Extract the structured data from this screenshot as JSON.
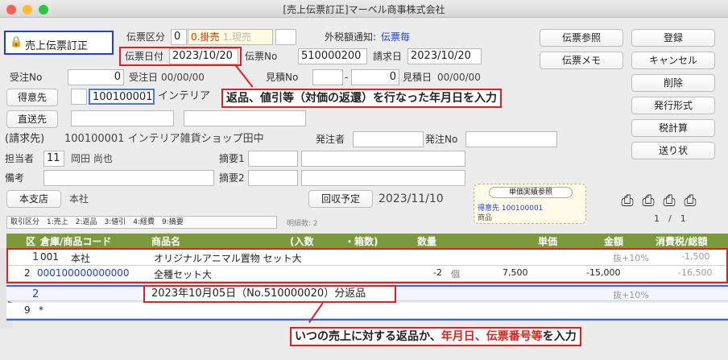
{
  "window": {
    "title": "[売上伝票訂正]マーベル商事株式会社"
  },
  "mode": {
    "label": "売上伝票訂正"
  },
  "header": {
    "kubun_label": "伝票区分",
    "kubun_value": "0",
    "kubun_opt1": "0.掛売",
    "kubun_opt2": "1.現売",
    "tax_label": "外税額通知:",
    "tax_value": "伝票毎",
    "date_label": "伝票日付",
    "date_value": "2023/10/20",
    "no_label": "伝票No",
    "no_value": "510000200",
    "bill_label": "請求日",
    "bill_value": "2023/10/20",
    "order_label": "受注No",
    "order_value": "0",
    "order_date_label": "受注日",
    "order_date_value": "00/00/00",
    "est_label": "見積No",
    "est_value": "0",
    "est_date_label": "見積日",
    "est_date_value": "00/00/00",
    "customer_btn": "得意先",
    "customer_code": "100100001",
    "customer_name": "インテリア",
    "ship_btn": "直送先",
    "bill_to_label": "(請求先)",
    "bill_to_value": "100100001 インテリア雑貨ショップ田中",
    "orderer_label": "発注者",
    "orderno_label": "発注No",
    "staff_label": "担当者",
    "staff_code": "11",
    "staff_name": "岡田 尚也",
    "memo1_label": "摘要1",
    "memo2_label": "摘要2",
    "note_label": "備考",
    "branch_btn": "本支店",
    "branch_value": "本社",
    "collect_btn": "回収予定",
    "collect_date": "2023/11/10",
    "ref_title": "単価実績参照",
    "ref_cust": "得意先 100100001",
    "ref_item": "商品",
    "trade_legend": "取引区分　1:売上　2:返品　3:値引　4:経費　9:摘要",
    "detail_count": "明細数: 2",
    "page": "1　/　1"
  },
  "buttons": {
    "ref": "伝票参照",
    "save": "登録",
    "memo": "伝票メモ",
    "cancel": "キャンセル",
    "delete": "削除",
    "issue": "発行形式",
    "tax": "税計算",
    "slip": "送り状"
  },
  "annotations": {
    "top": "返品、値引等（対価の返還）を行なった年月日を入力",
    "bottom_a": "いつの売上に対する返品か、",
    "bottom_b": "年月日、伝票番号等",
    "bottom_c": "を入力"
  },
  "grid": {
    "headers": [
      "区",
      "倉庫/商品コード",
      "商品名",
      "(入数",
      "・箱数)",
      "数量",
      "単価",
      "金額",
      "消費税/総額"
    ],
    "rows": [
      {
        "ku": "1",
        "code": "001",
        "store": "本社",
        "name": "オリジナルアニマル置物 セット大",
        "qty": "",
        "unit": "",
        "price": "",
        "amount": "",
        "tax": "抜+10%",
        "total": "-1,500"
      },
      {
        "ku": "2",
        "code": "000100000000000",
        "store": "",
        "name": "全種セット大",
        "qty": "-2",
        "unit": "個",
        "price": "7,500",
        "amount": "-15,000",
        "tax": "",
        "total": "-16,500"
      },
      {
        "ku": "2",
        "code": "",
        "store": "",
        "name": "2023年10月05日（No.510000020）分返品",
        "qty": "",
        "unit": "",
        "price": "",
        "amount": "",
        "tax": "抜+10%",
        "total": ""
      },
      {
        "ku": "9",
        "code": "*",
        "store": "",
        "name": "",
        "qty": "",
        "unit": "",
        "price": "",
        "amount": "",
        "tax": "",
        "total": ""
      }
    ]
  }
}
